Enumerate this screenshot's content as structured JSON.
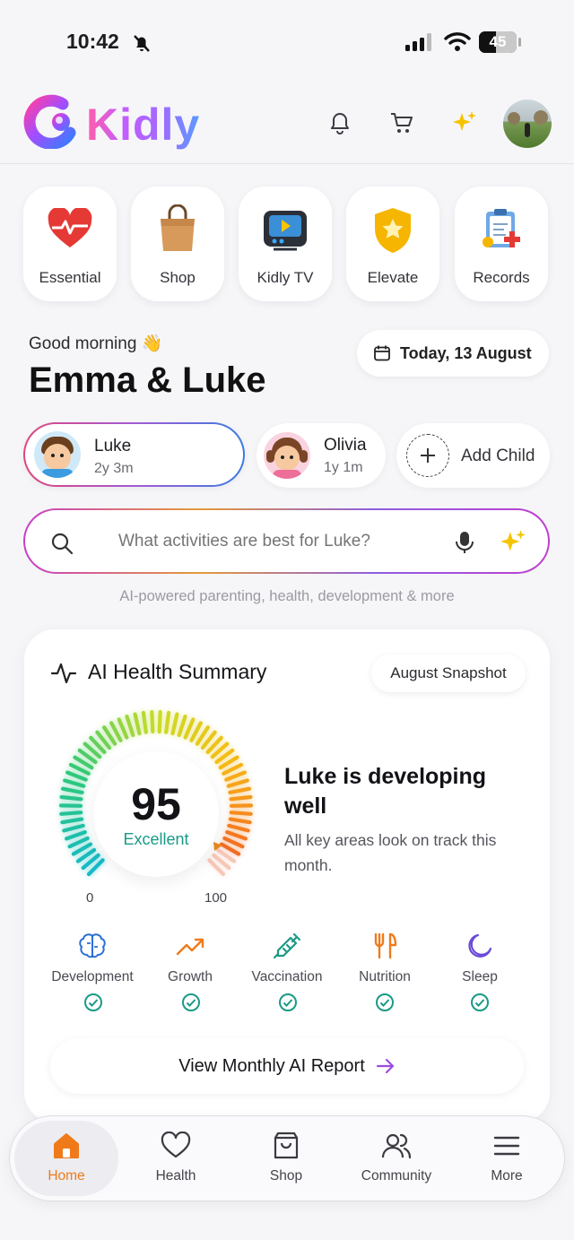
{
  "status_bar": {
    "time": "10:42",
    "battery": "45"
  },
  "header": {
    "brand": "Kidly"
  },
  "quick_tiles": [
    {
      "label": "Essential",
      "icon": "heart-pulse-icon"
    },
    {
      "label": "Shop",
      "icon": "shopping-bag-icon"
    },
    {
      "label": "Kidly TV",
      "icon": "tv-play-icon"
    },
    {
      "label": "Elevate",
      "icon": "star-shield-icon"
    },
    {
      "label": "Records",
      "icon": "clipboard-records-icon"
    }
  ],
  "greeting": {
    "text": "Good morning 👋",
    "names": "Emma & Luke",
    "date_chip": "Today, 13 August"
  },
  "children": [
    {
      "name": "Luke",
      "age": "2y 3m",
      "selected": true
    },
    {
      "name": "Olivia",
      "age": "1y 1m",
      "selected": false
    }
  ],
  "add_child": {
    "label": "Add Child"
  },
  "search": {
    "placeholder": "What activities are best for Luke?",
    "caption": "AI-powered parenting, health, development & more"
  },
  "health_card": {
    "title": "AI Health Summary",
    "snapshot": "August Snapshot",
    "score": "95",
    "score_label": "Excellent",
    "gauge_min": "0",
    "gauge_max": "100",
    "gauge_value": 95,
    "headline": "Luke is developing well",
    "subtext": "All key areas look on track this month.",
    "categories": [
      {
        "label": "Development",
        "icon": "brain-icon",
        "color": "#2b6fd6"
      },
      {
        "label": "Growth",
        "icon": "trend-up-icon",
        "color": "#f07a1a"
      },
      {
        "label": "Vaccination",
        "icon": "syringe-icon",
        "color": "#1a9a86"
      },
      {
        "label": "Nutrition",
        "icon": "fork-knife-icon",
        "color": "#f07a1a"
      },
      {
        "label": "Sleep",
        "icon": "moon-icon",
        "color": "#6b4ad6"
      }
    ],
    "report_button": "View Monthly AI Report"
  },
  "bottom_nav": [
    {
      "label": "Home",
      "active": true
    },
    {
      "label": "Health",
      "active": false
    },
    {
      "label": "Shop",
      "active": false
    },
    {
      "label": "Community",
      "active": false
    },
    {
      "label": "More",
      "active": false
    }
  ],
  "colors": {
    "accent": "#f07a1a",
    "success": "#1a9a86",
    "brand_purple": "#9b4de0"
  }
}
